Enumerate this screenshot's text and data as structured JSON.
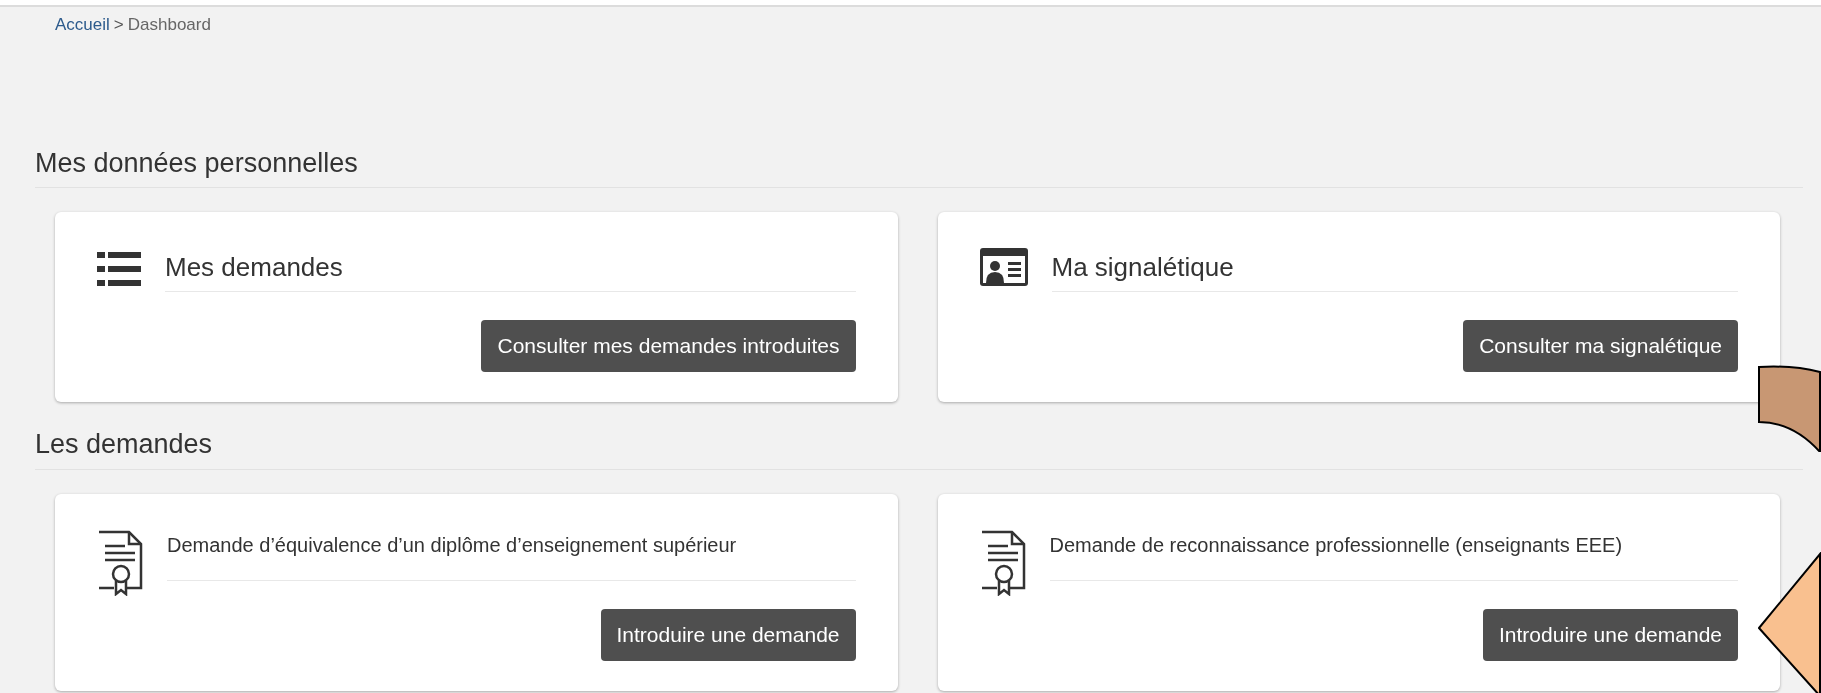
{
  "breadcrumb": {
    "link": "Accueil",
    "separator": ">",
    "current": "Dashboard"
  },
  "sections": [
    {
      "title": "Mes données personnelles",
      "cards": [
        {
          "kind": "list",
          "title": "Mes demandes",
          "button": "Consulter mes demandes introduites"
        },
        {
          "kind": "id-card",
          "title": "Ma signalétique",
          "button": "Consulter ma signalétique"
        }
      ]
    },
    {
      "title": "Les demandes",
      "cards": [
        {
          "kind": "certificate",
          "title": "Demande d’équivalence d’un diplôme d’enseignement supérieur",
          "button": "Introduire une demande"
        },
        {
          "kind": "certificate",
          "title": "Demande de reconnaissance professionnelle (enseignants EEE)",
          "button": "Introduire une demande"
        }
      ]
    }
  ]
}
